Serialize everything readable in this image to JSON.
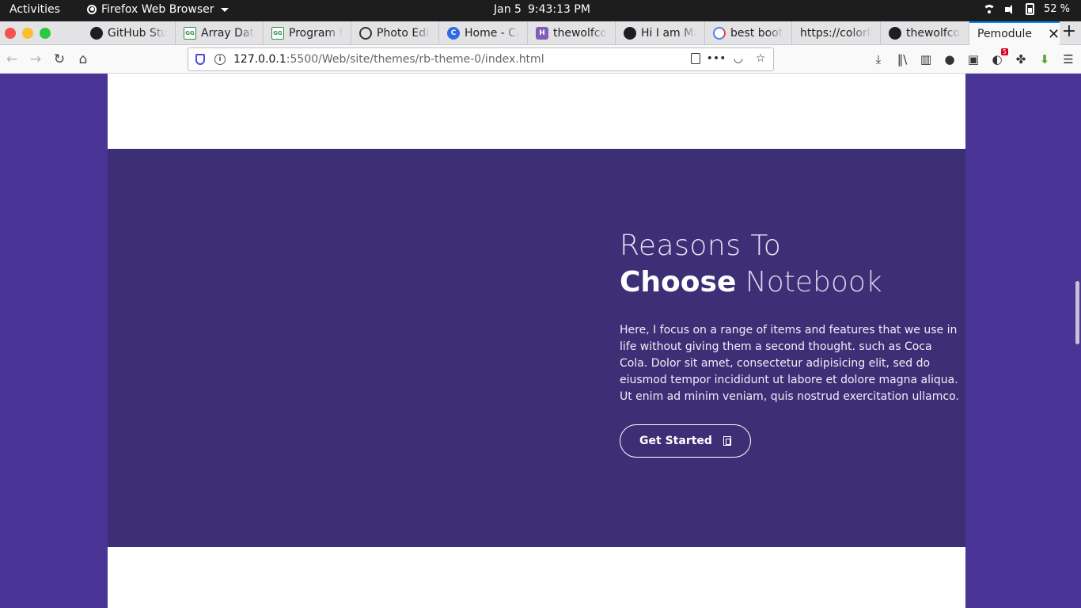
{
  "topbar": {
    "activities": "Activities",
    "app_name": "Firefox Web Browser",
    "date": "Jan 5",
    "time": "9:43:13 PM",
    "battery": "52 %"
  },
  "tabs": [
    {
      "label": "GitHub Stu",
      "icon": "github-icon"
    },
    {
      "label": "Array Data",
      "icon": "gfg-icon"
    },
    {
      "label": "Program fo",
      "icon": "gfg-icon"
    },
    {
      "label": "Photo Edit",
      "icon": "aperture-icon"
    },
    {
      "label": "Home - Ca",
      "icon": "canva-icon"
    },
    {
      "label": "thewolfcon",
      "icon": "heroku-icon"
    },
    {
      "label": "Hi I am Ma",
      "icon": "github-icon"
    },
    {
      "label": "best boots",
      "icon": "google-icon"
    },
    {
      "label": "https://colorlib",
      "icon": "none"
    },
    {
      "label": "thewolfcon",
      "icon": "github-icon"
    }
  ],
  "active_tab": {
    "label": "Pemodule"
  },
  "url": {
    "host": "127.0.0.1",
    "path": ":5500/Web/site/themes/rb-theme-0/index.html"
  },
  "toolbar": {
    "badge_count": "5"
  },
  "section": {
    "heading_line1": "Reasons To",
    "heading_bold": "Choose",
    "heading_light": "Notebook",
    "description": "Here, I focus on a range of items and features that we use in life without giving them a second thought. such as Coca Cola. Dolor sit amet, consectetur adipisicing elit, sed do eiusmod tempor incididunt ut labore et dolore magna aliqua. Ut enim ad minim veniam, quis nostrud exercitation ullamco.",
    "cta_label": "Get Started"
  },
  "colors": {
    "page_bg": "#4a3496",
    "section_bg": "#3d2f75",
    "accent": "#0a84ff"
  }
}
